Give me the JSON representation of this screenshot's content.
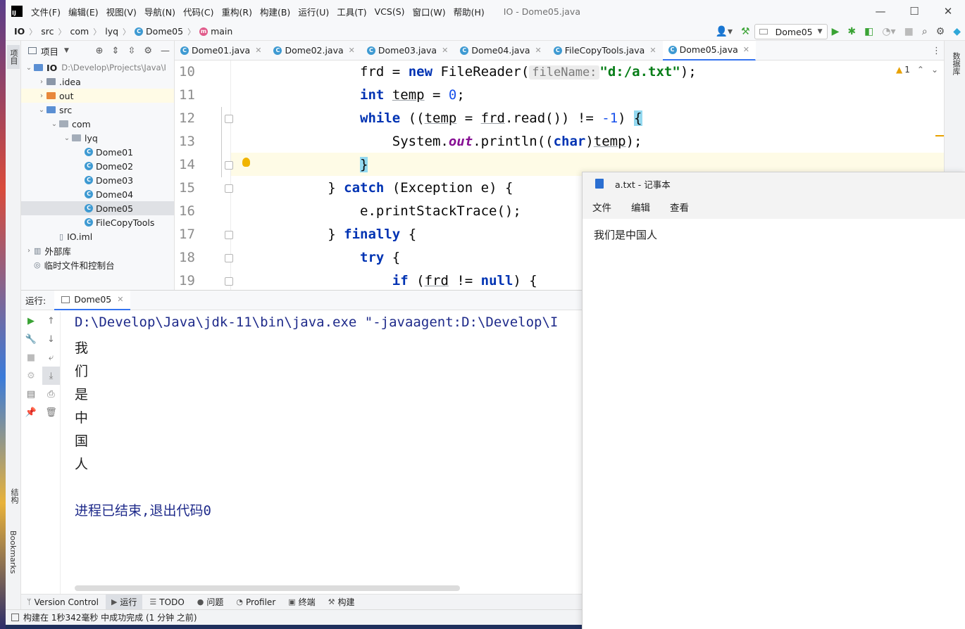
{
  "menubar": {
    "logo": "IJ",
    "items": [
      "文件(F)",
      "编辑(E)",
      "视图(V)",
      "导航(N)",
      "代码(C)",
      "重构(R)",
      "构建(B)",
      "运行(U)",
      "工具(T)",
      "VCS(S)",
      "窗口(W)",
      "帮助(H)"
    ],
    "title": "IO - Dome05.java",
    "controls": {
      "minimize": "—",
      "maximize": "☐",
      "close": "✕"
    }
  },
  "navbar": {
    "crumbs": [
      "IO",
      "src",
      "com",
      "lyq",
      "Dome05",
      "main"
    ],
    "run_config": "Dome05"
  },
  "left_stripe": {
    "project": "项目",
    "structure": "结构",
    "bookmarks": "Bookmarks"
  },
  "right_stripe": {
    "database": "数据库"
  },
  "project": {
    "header": "项目",
    "tree": [
      {
        "label": "IO",
        "extra": "D:\\Develop\\Projects\\Java\\I",
        "indent": 0,
        "arrow": "⌄",
        "icon": "folder-blue"
      },
      {
        "label": ".idea",
        "indent": 1,
        "arrow": "›",
        "icon": "folder"
      },
      {
        "label": "out",
        "indent": 1,
        "arrow": "›",
        "icon": "folder-orange"
      },
      {
        "label": "src",
        "indent": 1,
        "arrow": "⌄",
        "icon": "folder-blue"
      },
      {
        "label": "com",
        "indent": 2,
        "arrow": "⌄",
        "icon": "package"
      },
      {
        "label": "lyq",
        "indent": 3,
        "arrow": "⌄",
        "icon": "package"
      },
      {
        "label": "Dome01",
        "indent": 4,
        "arrow": "",
        "icon": "class"
      },
      {
        "label": "Dome02",
        "indent": 4,
        "arrow": "",
        "icon": "class"
      },
      {
        "label": "Dome03",
        "indent": 4,
        "arrow": "",
        "icon": "class"
      },
      {
        "label": "Dome04",
        "indent": 4,
        "arrow": "",
        "icon": "class"
      },
      {
        "label": "Dome05",
        "indent": 4,
        "arrow": "",
        "icon": "class"
      },
      {
        "label": "FileCopyTools",
        "indent": 4,
        "arrow": "",
        "icon": "class"
      },
      {
        "label": "IO.iml",
        "indent": 2,
        "arrow": "",
        "icon": "file"
      },
      {
        "label": "外部库",
        "indent": 0,
        "arrow": "›",
        "icon": "library"
      },
      {
        "label": "临时文件和控制台",
        "indent": 0,
        "arrow": "",
        "icon": "scratch"
      }
    ]
  },
  "editor": {
    "tabs": [
      "Dome01.java",
      "Dome02.java",
      "Dome03.java",
      "Dome04.java",
      "FileCopyTools.java",
      "Dome05.java"
    ],
    "active_tab": "Dome05.java",
    "warnings": "1",
    "line_numbers": [
      "10",
      "11",
      "12",
      "13",
      "14",
      "15",
      "16",
      "17",
      "18",
      "19"
    ],
    "code": {
      "l10_var": "frd",
      "l10_eq": " = ",
      "l10_new": "new",
      "l10_cls": " FileReader(",
      "l10_hint": "fileName:",
      "l10_str": "\"d:/a.txt\"",
      "l10_end": ");",
      "l11_int": "int",
      "l11_var": "temp",
      "l11_eq": " = ",
      "l11_num": "0",
      "l11_end": ";",
      "l12_while": "while",
      "l12_a": " ((",
      "l12_temp": "temp",
      "l12_b": " = ",
      "l12_frd": "frd",
      "l12_c": ".read()) != ",
      "l12_num": "-1",
      "l12_d": ") ",
      "l12_brace": "{",
      "l13_a": "System.",
      "l13_out": "out",
      "l13_b": ".println((",
      "l13_char": "char",
      "l13_c": ")",
      "l13_temp": "temp",
      "l13_d": ");",
      "l14_brace": "}",
      "l15_a": "} ",
      "l15_catch": "catch",
      "l15_b": " (Exception e) {",
      "l16": "e.printStackTrace();",
      "l17_a": "} ",
      "l17_finally": "finally",
      "l17_b": " {",
      "l18_try": "try",
      "l18_b": " {",
      "l19_if": "if",
      "l19_a": " (",
      "l19_frd": "frd",
      "l19_b": " != ",
      "l19_null": "null",
      "l19_c": ") {"
    }
  },
  "run": {
    "label": "运行:",
    "tab": "Dome05",
    "command": "D:\\Develop\\Java\\jdk-11\\bin\\java.exe \"-javaagent:D:\\Develop\\I",
    "output": [
      "我",
      "们",
      "是",
      "中",
      "国",
      "人"
    ],
    "exit": "进程已结束,退出代码0"
  },
  "bottom_tabs": [
    "Version Control",
    "运行",
    "TODO",
    "问题",
    "Profiler",
    "终端",
    "构建"
  ],
  "status": "构建在 1秒342毫秒 中成功完成 (1 分钟 之前)",
  "notepad": {
    "title": "a.txt - 记事本",
    "menu": [
      "文件",
      "编辑",
      "查看"
    ],
    "content": "我们是中国人"
  }
}
